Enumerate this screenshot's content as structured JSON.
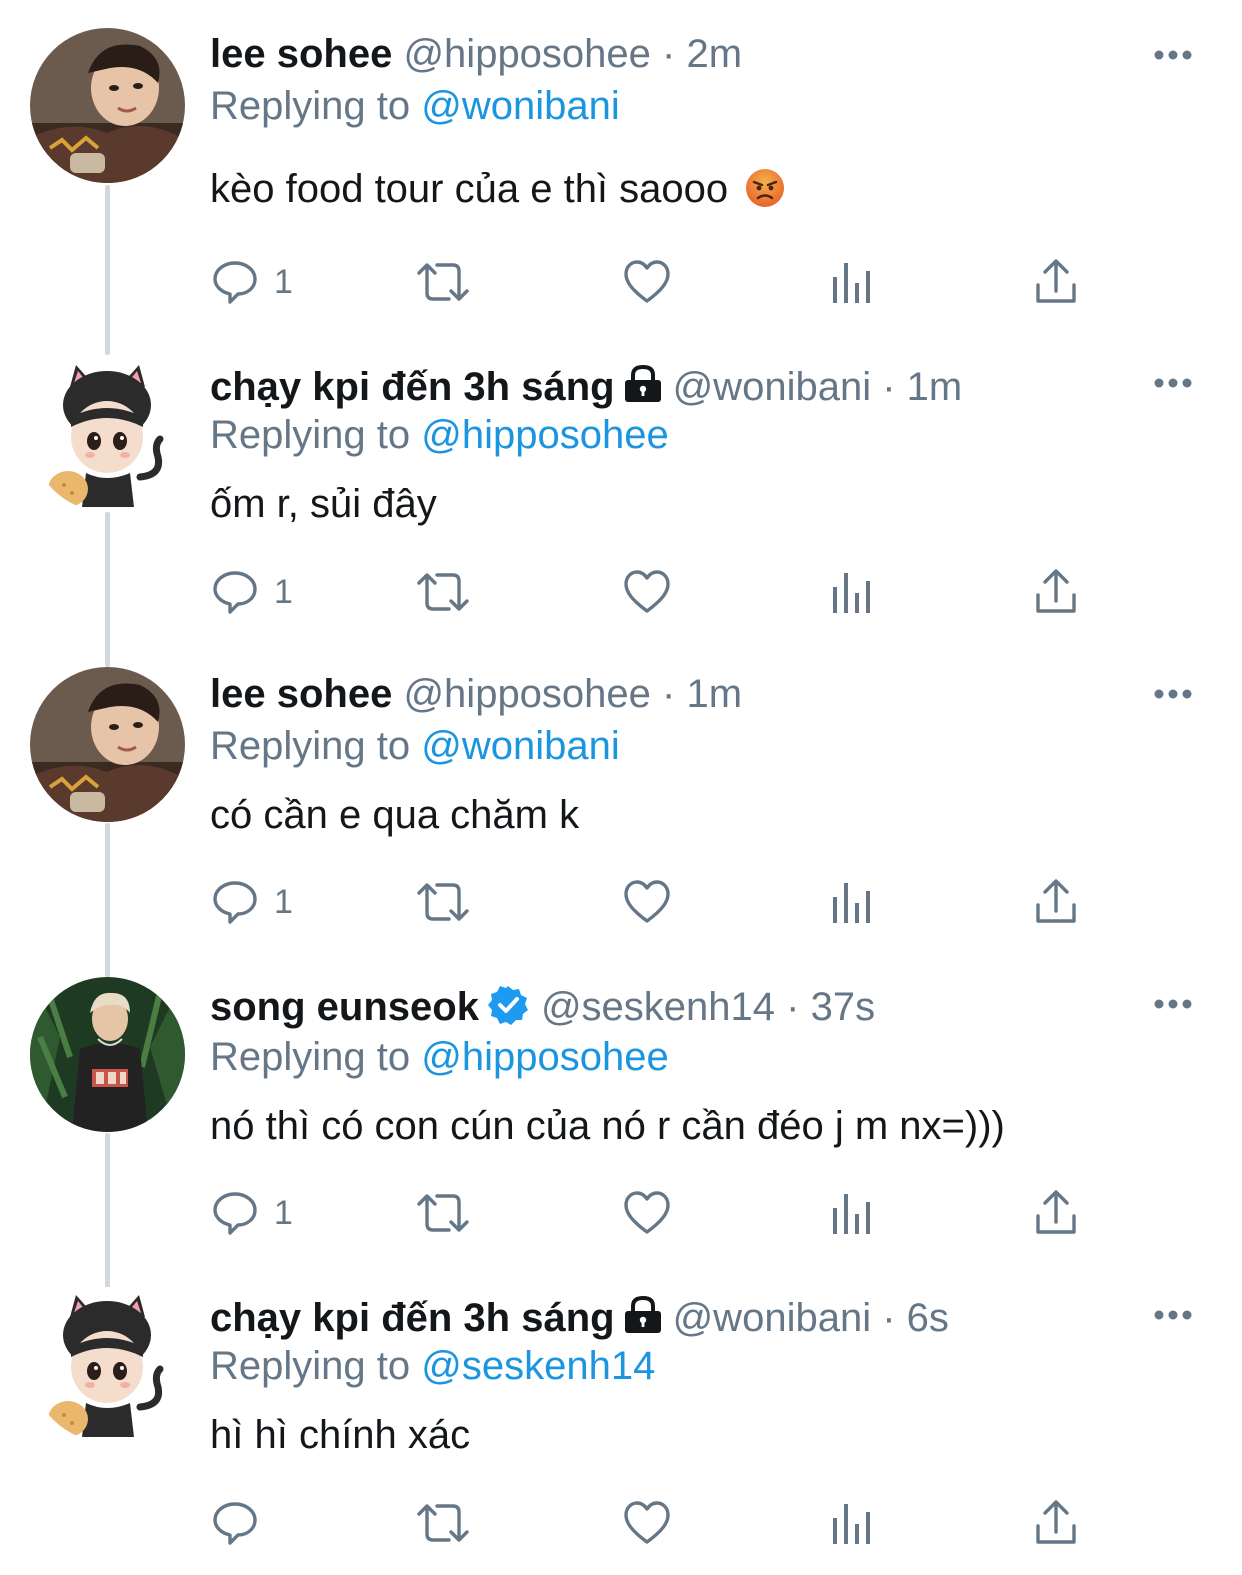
{
  "colors": {
    "text": "#14171a",
    "secondary": "#657786",
    "accent": "#1b95e0",
    "thread_line": "#cfd9de"
  },
  "replying_prefix": "Replying to",
  "tweets": [
    {
      "name": "lee sohee",
      "handle": "@hipposohee",
      "sep": "·",
      "time": "2m",
      "replying_to": "@wonibani",
      "text": "kèo food tour của e thì saooo",
      "emoji": "angry-face-emoji",
      "reply_count": "1",
      "avatar": "photo-avatar-person",
      "locked": false,
      "verified": false
    },
    {
      "name": "chạy kpi đến 3h sáng",
      "handle": "@wonibani",
      "sep": "·",
      "time": "1m",
      "replying_to": "@hipposohee",
      "text": "ốm r, sủi đây",
      "reply_count": "1",
      "avatar": "cat-doll-avatar",
      "locked": true,
      "verified": false
    },
    {
      "name": "lee sohee",
      "handle": "@hipposohee",
      "sep": "·",
      "time": "1m",
      "replying_to": "@wonibani",
      "text": "có cần e qua chăm k",
      "reply_count": "1",
      "avatar": "photo-avatar-person",
      "locked": false,
      "verified": false
    },
    {
      "name": "song eunseok",
      "handle": "@seskenh14",
      "sep": "·",
      "time": "37s",
      "replying_to": "@hipposohee",
      "text": "nó thì có con cún của nó r cần đéo j m nx=)))",
      "reply_count": "1",
      "avatar": "photo-avatar-person-forest",
      "locked": false,
      "verified": true
    },
    {
      "name": "chạy kpi đến 3h sáng",
      "handle": "@wonibani",
      "sep": "·",
      "time": "6s",
      "replying_to": "@seskenh14",
      "text": "hì hì chính xác",
      "reply_count": "",
      "avatar": "cat-doll-avatar",
      "locked": true,
      "verified": false
    }
  ],
  "icons": {
    "reply": "reply-icon",
    "retweet": "retweet-icon",
    "like": "like-icon",
    "analytics": "analytics-icon",
    "share": "share-icon",
    "more": "more-icon",
    "lock": "lock-icon",
    "verified": "verified-badge-icon"
  }
}
